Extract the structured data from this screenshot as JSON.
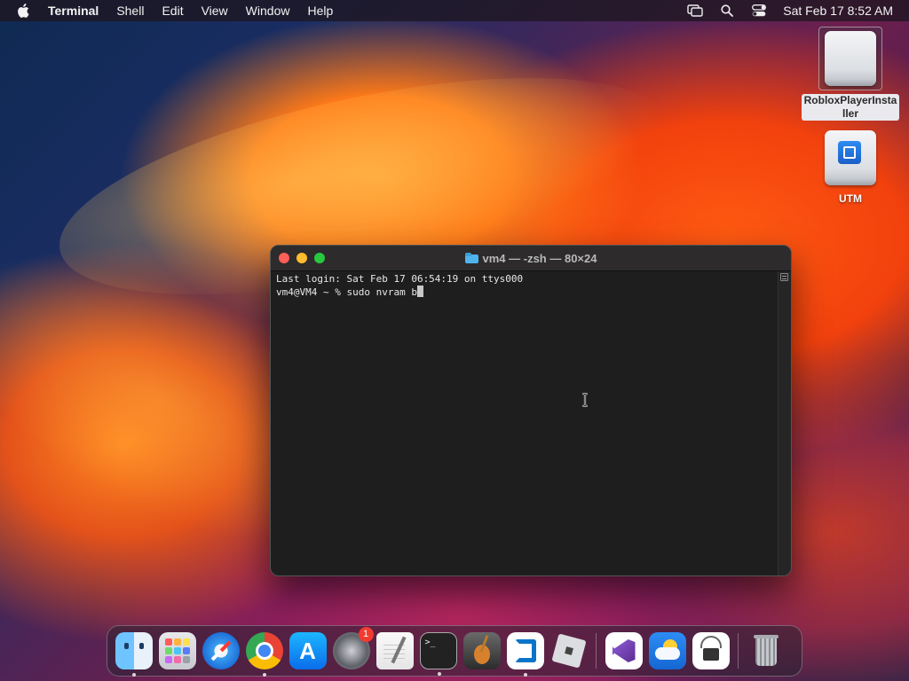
{
  "menubar": {
    "app_name": "Terminal",
    "items": [
      "Shell",
      "Edit",
      "View",
      "Window",
      "Help"
    ],
    "clock": "Sat Feb 17  8:52 AM",
    "status_icons": [
      "screen-mirroring-icon",
      "search-icon",
      "control-center-icon"
    ]
  },
  "desktop": {
    "icons": [
      {
        "label": "RobloxPlayerInstaller",
        "icon": "disk-image-icon",
        "selected": true
      },
      {
        "label": "UTM",
        "icon": "utm-volume-icon",
        "selected": false
      }
    ]
  },
  "terminal": {
    "title": "vm4 — -zsh — 80×24",
    "lines": [
      "Last login: Sat Feb 17 06:54:19 on ttys000",
      "vm4@VM4 ~ % sudo nvram b"
    ]
  },
  "dock": {
    "apps": [
      {
        "name": "Finder",
        "running": true
      },
      {
        "name": "Launchpad",
        "running": false
      },
      {
        "name": "Safari",
        "running": false
      },
      {
        "name": "Google Chrome",
        "running": true
      },
      {
        "name": "App Store",
        "running": false
      },
      {
        "name": "System Settings",
        "running": false,
        "badge": "1"
      },
      {
        "name": "TextEdit",
        "running": false
      },
      {
        "name": "Terminal",
        "running": true
      },
      {
        "name": "GarageBand",
        "running": false
      },
      {
        "name": "Visual Studio Code",
        "running": true
      },
      {
        "name": "Roblox",
        "running": false
      },
      {
        "name": "Visual Studio",
        "running": false
      },
      {
        "name": "Weather",
        "running": false
      },
      {
        "name": "System Information",
        "running": false
      },
      {
        "name": "Trash",
        "running": false
      }
    ]
  }
}
